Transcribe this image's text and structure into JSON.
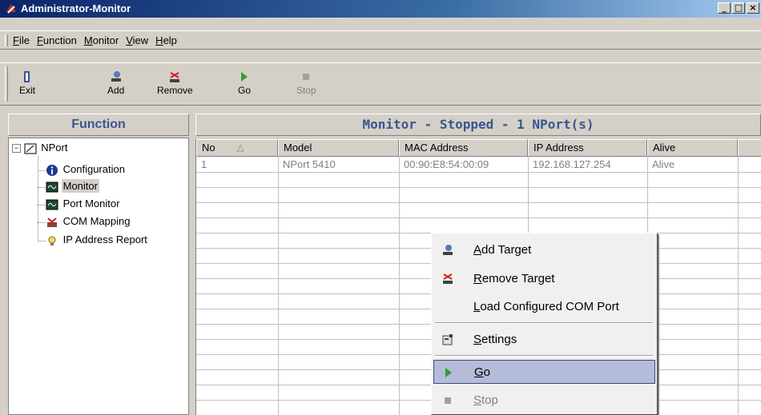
{
  "window": {
    "title": "Administrator-Monitor",
    "minimize": "_",
    "maximize": "□",
    "close": "×"
  },
  "menu": [
    "File",
    "Function",
    "Monitor",
    "View",
    "Help"
  ],
  "toolbar": {
    "exit": "Exit",
    "add": "Add",
    "remove": "Remove",
    "go": "Go",
    "stop": "Stop"
  },
  "left_panel": {
    "header": "Function",
    "tree": {
      "root": "NPort",
      "children": [
        "Configuration",
        "Monitor",
        "Port Monitor",
        "COM Mapping",
        "IP Address Report"
      ]
    }
  },
  "right_panel": {
    "header": "Monitor - Stopped - 1 NPort(s)",
    "columns": [
      "No",
      "Model",
      "MAC Address",
      "IP Address",
      "Alive"
    ],
    "rows": [
      [
        "1",
        "NPort 5410",
        "00:90:E8:54:00:09",
        "192.168.127.254",
        "Alive"
      ]
    ]
  },
  "context_menu": {
    "items": [
      "Add Target",
      "Remove Target",
      "Load Configured COM Port",
      "Settings",
      "Go",
      "Stop"
    ]
  },
  "colors": {
    "header_text": "#3a5590",
    "highlight": "#b4bcd8",
    "title_bar": "#0a246a"
  }
}
